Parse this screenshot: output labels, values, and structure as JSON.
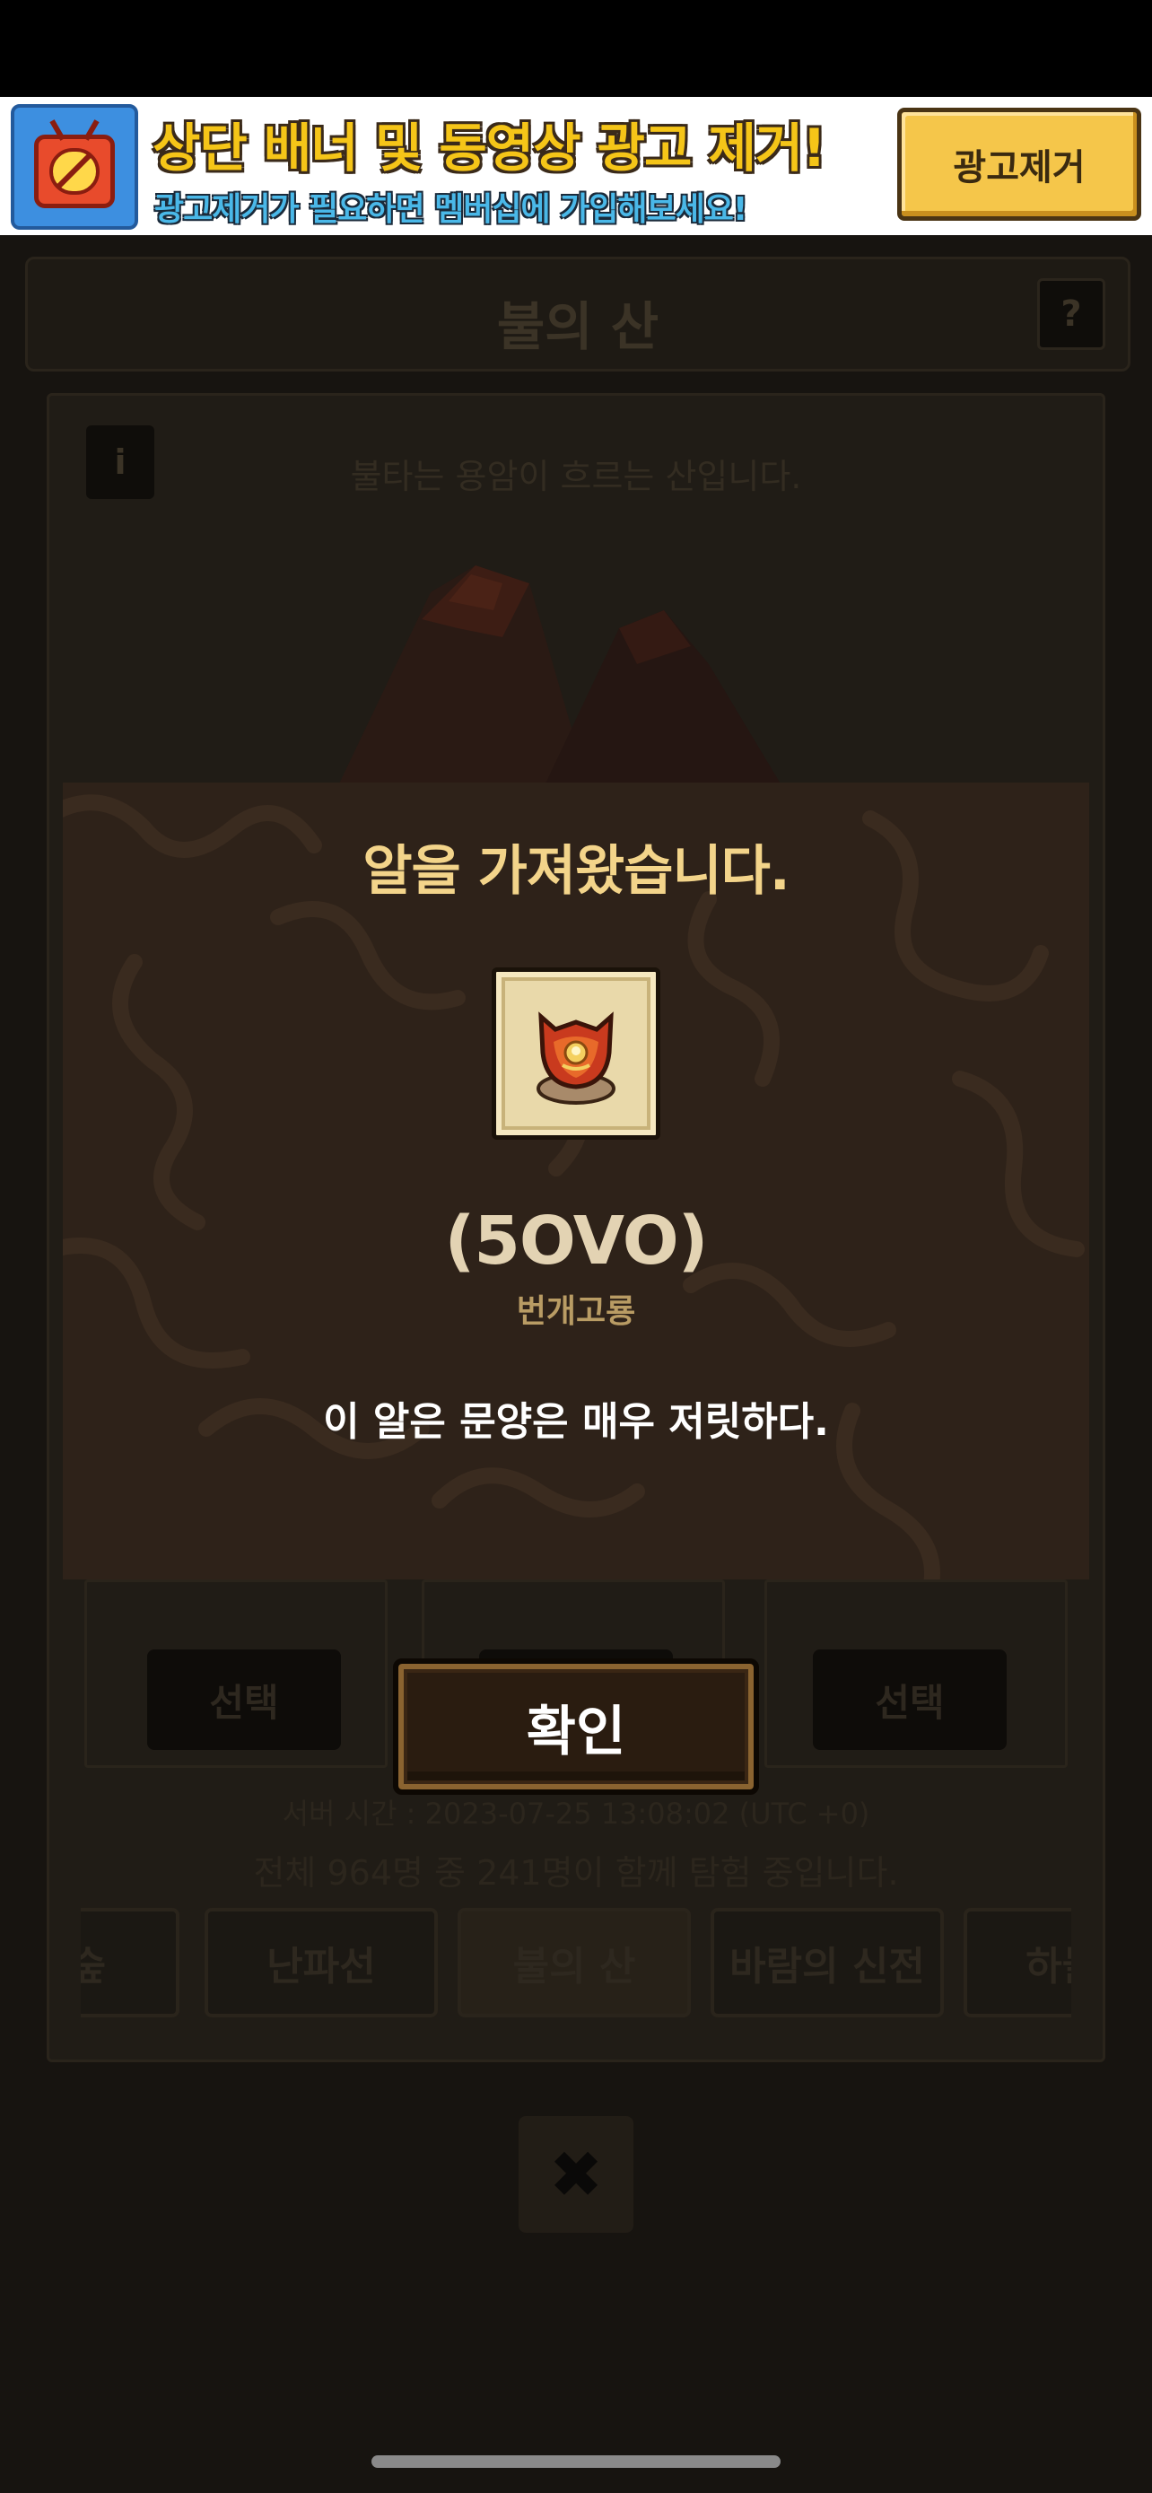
{
  "ad_banner": {
    "title": "상단 배너 및 동영상 광고 제거!",
    "subtitle": "광고제거가 필요하면 멤버십에 가입해보세요!",
    "remove_button": "광고제거",
    "icon": "no-ads-tv-icon"
  },
  "header": {
    "title": "불의 산",
    "help_label": "?"
  },
  "location": {
    "info_label": "i",
    "description": "불타는 용암이 흐르는 산입니다."
  },
  "slots": {
    "select_label": "선택"
  },
  "server_time": "서버 시간 : 2023-07-25 13:08:02 (UTC +0)",
  "participants": "전체 964명 중 241명이 함께 탐험 중입니다.",
  "tabs": [
    {
      "label": "리 숲"
    },
    {
      "label": "난파선"
    },
    {
      "label": "불의 산",
      "active": true
    },
    {
      "label": "바람의 신전"
    },
    {
      "label": "하늘섬"
    }
  ],
  "close_label": "✖",
  "modal": {
    "title": "알을 가져왔습니다.",
    "egg_code": "(5OVO)",
    "egg_name": "번개고룡",
    "description": "이 알은 문양은 매우 저릿하다.",
    "egg_icon": "dragon-egg-icon"
  },
  "confirm_button": "확인",
  "colors": {
    "modal_bg": "#2e2219",
    "modal_title": "#f3d48a",
    "ad_accent": "#f5c64a"
  }
}
